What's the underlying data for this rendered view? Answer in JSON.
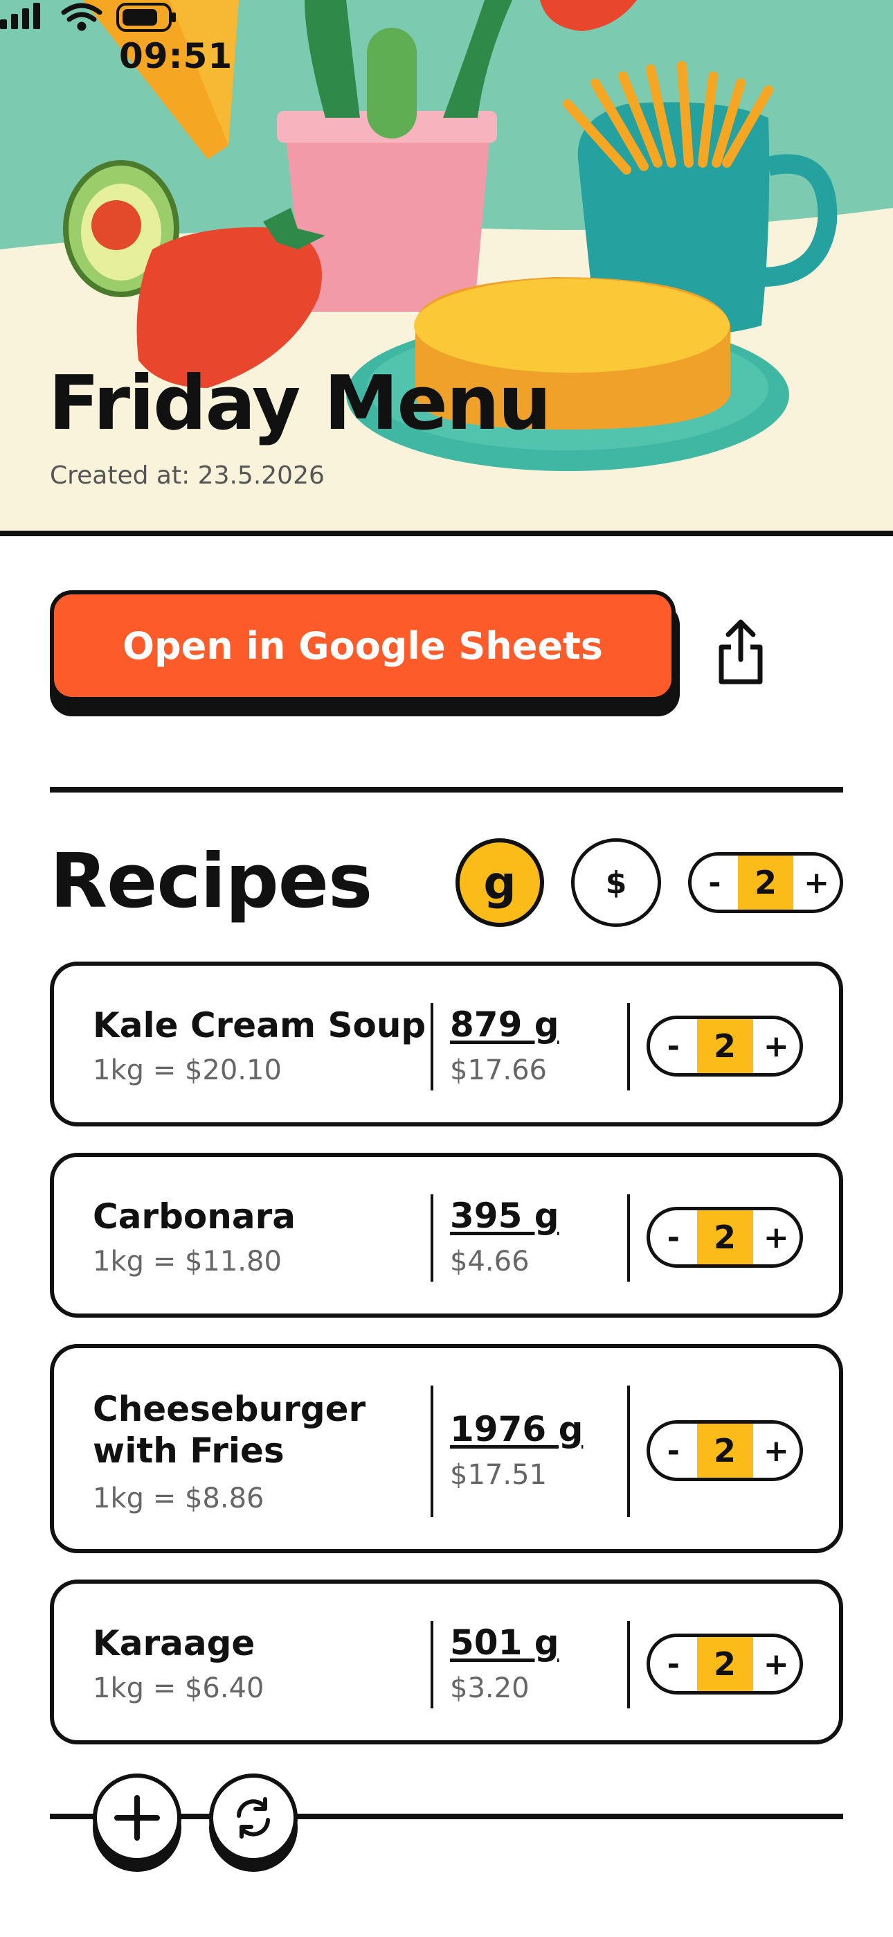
{
  "status_bar": {
    "time": "09:51"
  },
  "hero": {
    "title": "Friday Menu",
    "created": "Created at: 23.5.2026"
  },
  "actions": {
    "sheets_label": "Open in Google Sheets",
    "share_icon": "share-icon"
  },
  "recipes": {
    "title": "Recipes",
    "unit_grams": "g",
    "unit_dollars": "$",
    "global_servings": {
      "minus": "-",
      "value": "2",
      "plus": "+"
    },
    "items": [
      {
        "name": "Kale Cream Soup",
        "per_kg": "1kg = $20.10",
        "weight": "879 g",
        "price": "$17.66",
        "minus": "-",
        "servings": "2",
        "plus": "+"
      },
      {
        "name": "Carbonara",
        "per_kg": "1kg = $11.80",
        "weight": "395 g",
        "price": "$4.66",
        "minus": "-",
        "servings": "2",
        "plus": "+"
      },
      {
        "name": "Cheeseburger with Fries",
        "per_kg": "1kg = $8.86",
        "weight": "1976 g",
        "price": "$17.51",
        "minus": "-",
        "servings": "2",
        "plus": "+"
      },
      {
        "name": "Karaage",
        "per_kg": "1kg = $6.40",
        "weight": "501 g",
        "price": "$3.20",
        "minus": "-",
        "servings": "2",
        "plus": "+"
      }
    ]
  },
  "bottom": {
    "add_icon": "plus-icon",
    "refresh_icon": "refresh-icon"
  },
  "colors": {
    "accent_orange": "#fe5b2a",
    "accent_yellow": "#fbbc1a",
    "hero_teal": "#7ccbb0",
    "hero_cream": "#faf3dc"
  }
}
